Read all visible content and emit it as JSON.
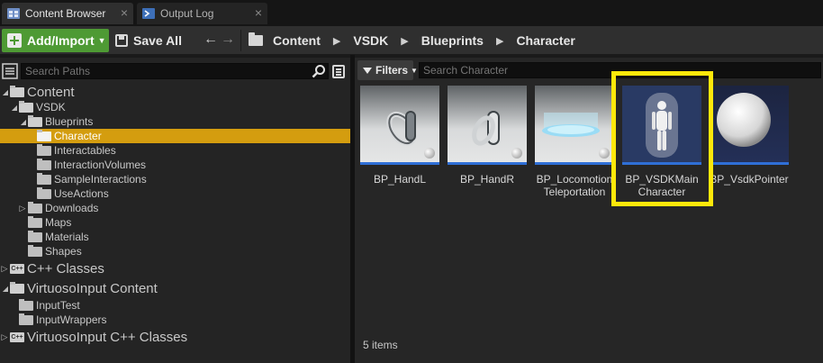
{
  "tabs": [
    {
      "label": "Content Browser",
      "icon": "content-browser-icon"
    },
    {
      "label": "Output Log",
      "icon": "output-log-icon"
    }
  ],
  "toolbar": {
    "add_import_label": "Add/Import",
    "save_all_label": "Save All",
    "breadcrumbs": [
      "Content",
      "VSDK",
      "Blueprints",
      "Character"
    ]
  },
  "sources": {
    "search_placeholder": "Search Paths",
    "tree": [
      {
        "label": "Content",
        "level": 0,
        "expanded": true,
        "kind": "root"
      },
      {
        "label": "VSDK",
        "level": 1,
        "expanded": true,
        "kind": "folder"
      },
      {
        "label": "Blueprints",
        "level": 2,
        "expanded": true,
        "kind": "folder"
      },
      {
        "label": "Character",
        "level": 3,
        "selected": true,
        "kind": "folder"
      },
      {
        "label": "Interactables",
        "level": 3,
        "kind": "folder"
      },
      {
        "label": "InteractionVolumes",
        "level": 3,
        "kind": "folder"
      },
      {
        "label": "SampleInteractions",
        "level": 3,
        "kind": "folder"
      },
      {
        "label": "UseActions",
        "level": 3,
        "kind": "folder"
      },
      {
        "label": "Downloads",
        "level": 2,
        "collapsed": true,
        "kind": "folder"
      },
      {
        "label": "Maps",
        "level": 2,
        "kind": "folder"
      },
      {
        "label": "Materials",
        "level": 2,
        "kind": "folder"
      },
      {
        "label": "Shapes",
        "level": 2,
        "kind": "folder"
      },
      {
        "label": "C++ Classes",
        "level": 0,
        "collapsed": true,
        "kind": "cpp"
      },
      {
        "label": "VirtuosoInput Content",
        "level": 0,
        "expanded": true,
        "kind": "root"
      },
      {
        "label": "InputTest",
        "level": 1,
        "kind": "folder"
      },
      {
        "label": "InputWrappers",
        "level": 1,
        "kind": "folder"
      },
      {
        "label": "VirtuosoInput C++ Classes",
        "level": 0,
        "collapsed": true,
        "kind": "cpp"
      }
    ]
  },
  "assets": {
    "filters_label": "Filters",
    "search_placeholder": "Search Character",
    "items": [
      {
        "name": "BP_HandL",
        "thumb": "hand-left"
      },
      {
        "name": "BP_HandR",
        "thumb": "hand-right"
      },
      {
        "name": "BP_Locomotion Teleportation",
        "thumb": "teleport-disc"
      },
      {
        "name": "BP_VSDKMain Character",
        "thumb": "mannequin",
        "highlighted": true
      },
      {
        "name": "BP_VsdkPointer",
        "thumb": "sphere"
      }
    ],
    "status": "5 items"
  },
  "colors": {
    "accent_green": "#4e9a34",
    "selection_orange": "#d49d0f",
    "highlight_yellow": "#ffe80a",
    "asset_bar_blue": "#2f6fd6"
  }
}
